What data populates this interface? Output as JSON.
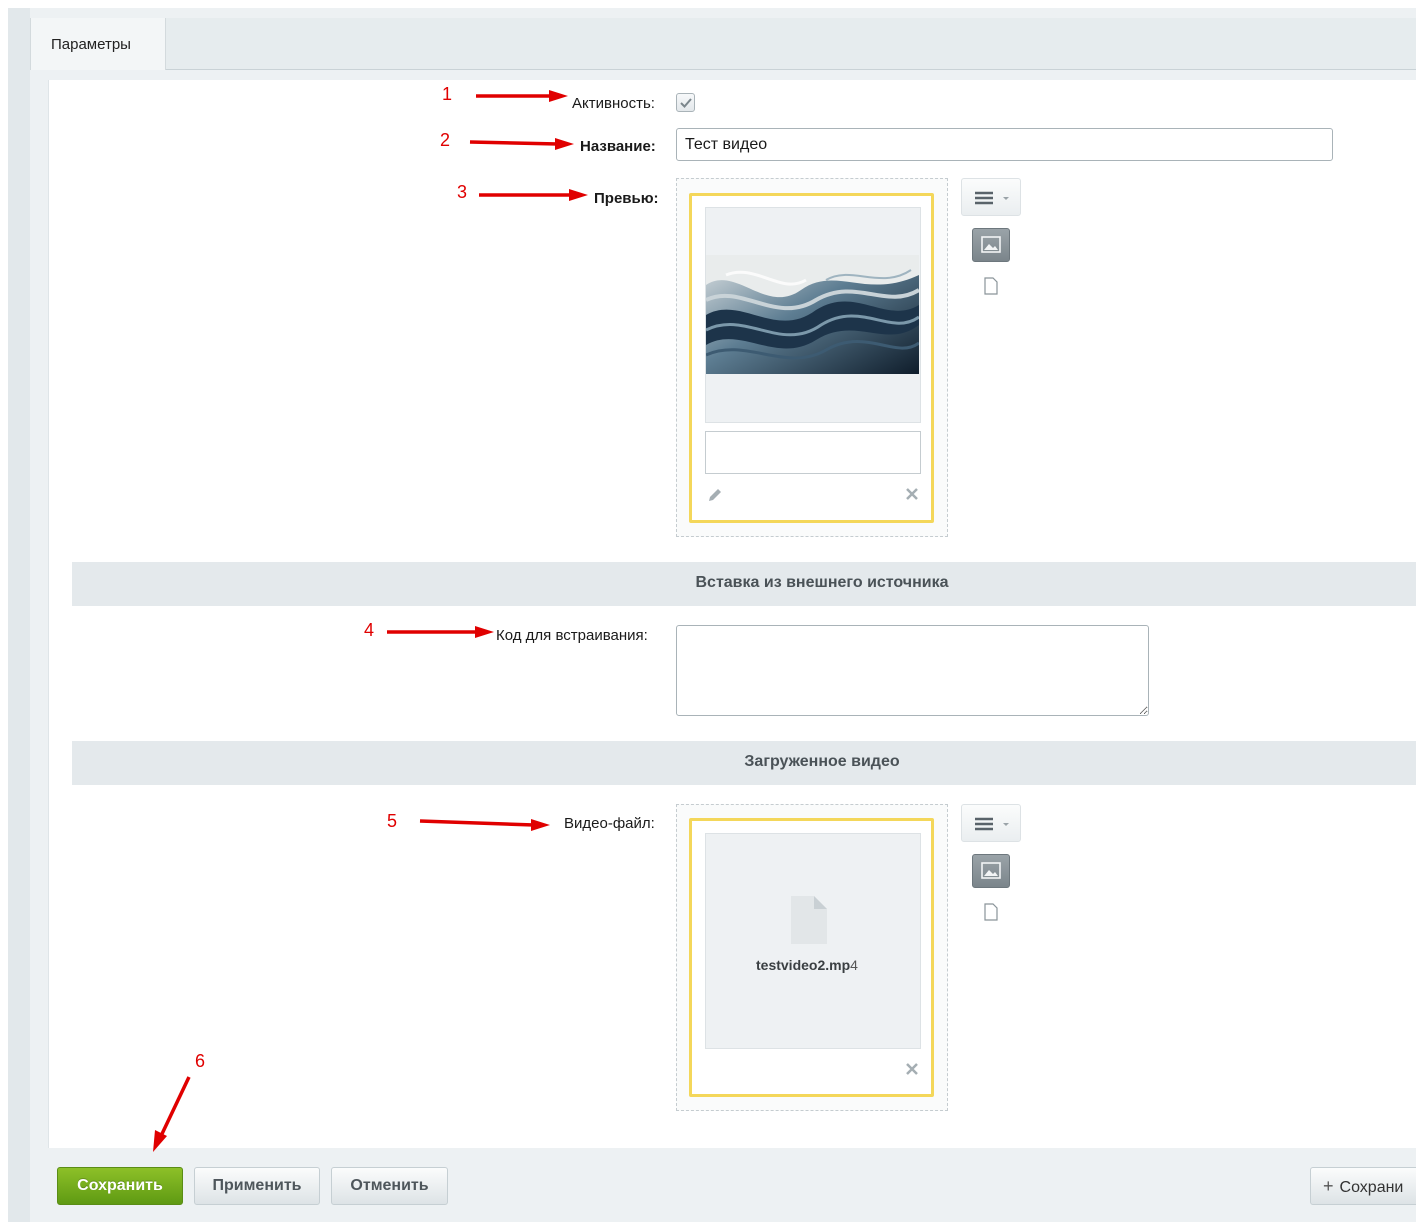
{
  "tabs": [
    {
      "label": "Параметры"
    }
  ],
  "fields": {
    "active": {
      "label": "Активность:",
      "checked": true
    },
    "name": {
      "label": "Название:",
      "value": "Тест видео"
    },
    "preview": {
      "label": "Превью:"
    },
    "embed_code": {
      "label": "Код для встраивания:",
      "value": ""
    },
    "video_file": {
      "label": "Видео-файл:",
      "file_name": "testvideo2.mp",
      "file_ext": "4"
    }
  },
  "sections": {
    "external": "Вставка из внешнего источника",
    "uploaded": "Загруженное видео"
  },
  "annotations": [
    "1",
    "2",
    "3",
    "4",
    "5",
    "6"
  ],
  "footer": {
    "save": "Сохранить",
    "apply": "Применить",
    "cancel": "Отменить",
    "save_and_add": "Сохрани"
  },
  "icons": {
    "menu": "menu-icon",
    "image": "image-icon",
    "document": "document-icon",
    "edit": "pencil-icon",
    "remove": "close-icon",
    "file": "file-icon",
    "plus": "plus-icon"
  },
  "colors": {
    "accent_yellow": "#f4d75a",
    "save_green": "#6ba41a",
    "annotation_red": "#e00000"
  }
}
